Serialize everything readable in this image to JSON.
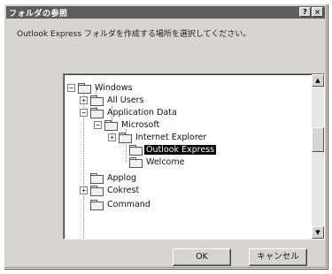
{
  "window": {
    "title": "フォルダの参照",
    "help_button": "?",
    "close_button": "×"
  },
  "instruction": "Outlook Express フォルダを作成する場所を選択してください。",
  "tree": {
    "items": [
      {
        "label": "Windows",
        "expander": "−"
      },
      {
        "label": "All Users",
        "expander": "+"
      },
      {
        "label": "Application Data",
        "expander": "−"
      },
      {
        "label": "Microsoft",
        "expander": "−"
      },
      {
        "label": "Internet Explorer",
        "expander": "+"
      },
      {
        "label": "Outlook Express",
        "expander": "",
        "selected": true
      },
      {
        "label": "Welcome",
        "expander": ""
      },
      {
        "label": "Applog",
        "expander": ""
      },
      {
        "label": "Cokrest",
        "expander": "+"
      },
      {
        "label": "Command",
        "expander": ""
      }
    ]
  },
  "scrollbar": {
    "up_arrow": "▲",
    "down_arrow": "▼"
  },
  "buttons": {
    "ok": "OK",
    "cancel": "キャンセル"
  }
}
